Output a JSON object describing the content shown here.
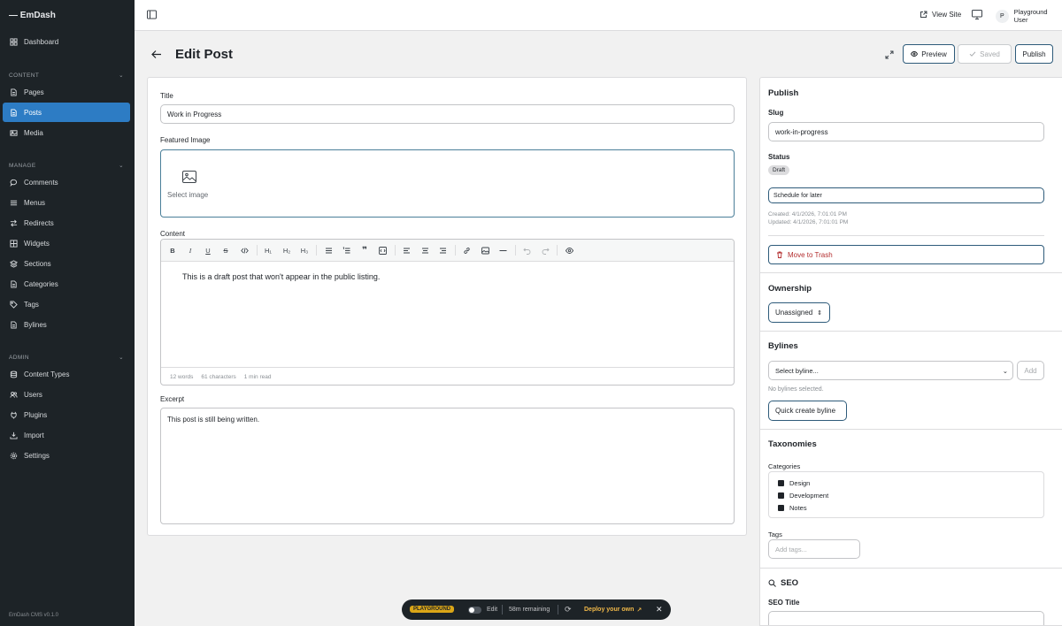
{
  "app": {
    "brand": "EmDash",
    "version": "EmDash CMS v0.1.0"
  },
  "sidebar": {
    "dashboard": "Dashboard",
    "sections": [
      {
        "title": "CONTENT",
        "items": [
          "Pages",
          "Posts",
          "Media"
        ]
      },
      {
        "title": "MANAGE",
        "items": [
          "Comments",
          "Menus",
          "Redirects",
          "Widgets",
          "Sections",
          "Categories",
          "Tags",
          "Bylines"
        ]
      },
      {
        "title": "ADMIN",
        "items": [
          "Content Types",
          "Users",
          "Plugins",
          "Import",
          "Settings"
        ]
      }
    ],
    "active": "Posts"
  },
  "topbar": {
    "view_site": "View Site",
    "user_initial": "P",
    "user_name": "Playground User"
  },
  "header": {
    "title": "Edit Post",
    "preview": "Preview",
    "saved": "Saved",
    "publish": "Publish"
  },
  "form": {
    "title_label": "Title",
    "title_value": "Work in Progress",
    "featured_label": "Featured Image",
    "select_image": "Select image",
    "content_label": "Content",
    "content_text": "This is a draft post that won't appear in the public listing.",
    "stats": {
      "words": "12 words",
      "chars": "61 characters",
      "read": "1 min read"
    },
    "excerpt_label": "Excerpt",
    "excerpt_value": "This post is still being written."
  },
  "toolbar": [
    "bold-icon",
    "italic-icon",
    "underline-icon",
    "strikethrough-icon",
    "code-icon",
    "heading-1-icon",
    "heading-2-icon",
    "heading-3-icon",
    "bullet-list-icon",
    "numbered-list-icon",
    "quote-icon",
    "code-block-icon",
    "align-left-icon",
    "align-center-icon",
    "align-right-icon",
    "link-icon",
    "image-icon",
    "divider-icon",
    "undo-icon",
    "redo-icon",
    "preview-eye-icon"
  ],
  "toolbar_heading_labels": {
    "h1": "H₁",
    "h2": "H₂",
    "h3": "H₃"
  },
  "panel": {
    "publish_title": "Publish",
    "slug_label": "Slug",
    "slug_value": "work-in-progress",
    "status_label": "Status",
    "status_value": "Draft",
    "schedule": "Schedule for later",
    "created": "Created: 4/1/2026, 7:01:01 PM",
    "updated": "Updated: 4/1/2026, 7:01:01 PM",
    "trash": "Move to Trash",
    "ownership_title": "Ownership",
    "ownership_value": "Unassigned",
    "bylines_title": "Bylines",
    "byline_select": "Select byline...",
    "add": "Add",
    "no_bylines": "No bylines selected.",
    "quick_create": "Quick create byline",
    "taxonomies_title": "Taxonomies",
    "categories_label": "Categories",
    "categories": [
      "Design",
      "Development",
      "Notes"
    ],
    "tags_label": "Tags",
    "tags_placeholder": "Add tags...",
    "seo_title": "SEO",
    "seo_field_label": "SEO Title"
  },
  "playground": {
    "badge": "PLAYGROUND",
    "edit": "Edit",
    "remaining": "58m remaining",
    "deploy": "Deploy your own"
  }
}
